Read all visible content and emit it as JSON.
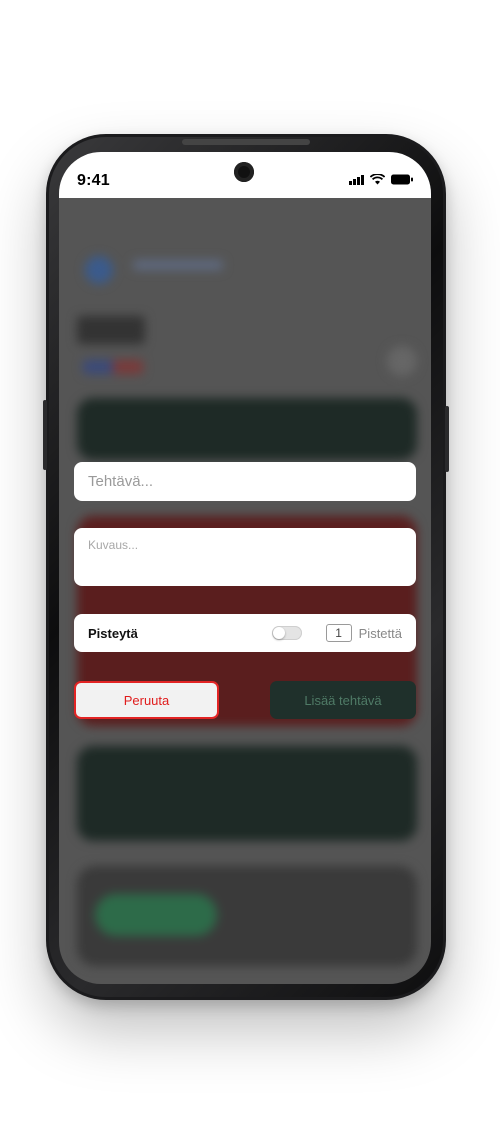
{
  "status_bar": {
    "time": "9:41"
  },
  "form": {
    "task_placeholder": "Tehtävä...",
    "description_placeholder": "Kuvaus...",
    "score_label": "Pisteytä",
    "score_toggle_on": false,
    "points_value": "1",
    "points_label": "Pistettä",
    "cancel_label": "Peruuta",
    "add_label": "Lisää tehtävä"
  },
  "colors": {
    "cancel_accent": "#e32424",
    "add_button_bg": "#1f302b",
    "overlay": "#555555"
  }
}
